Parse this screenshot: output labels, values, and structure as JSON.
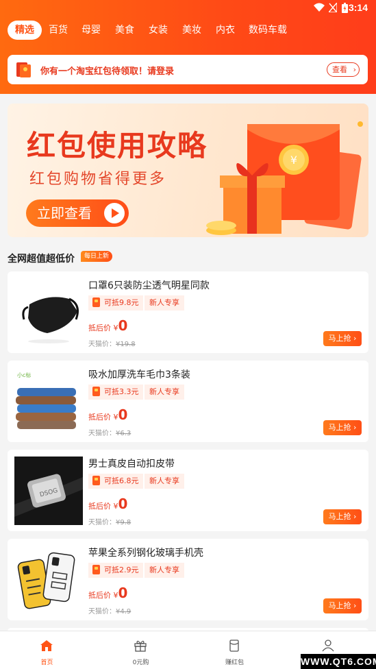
{
  "status_bar": {
    "time": "3:14"
  },
  "tabs": [
    "精选",
    "百货",
    "母婴",
    "美食",
    "女装",
    "美妆",
    "内衣",
    "数码车载"
  ],
  "notice": {
    "text": "你有一个淘宝红包待领取！请登录",
    "button": "查看"
  },
  "banner": {
    "title": "红包使用攻略",
    "subtitle": "红包购物省得更多",
    "cta": "立即查看"
  },
  "section": {
    "title": "全网超值超低价",
    "badge": "每日上新"
  },
  "products": [
    {
      "name": "口罩6只装防尘透气明星同款",
      "coupon": "可抵9.8元",
      "tag": "新人专享",
      "price_label": "抵后价 ¥",
      "price": "0",
      "orig_label": "天猫价：",
      "orig_price": "¥19.8",
      "button": "马上抢"
    },
    {
      "name": "吸水加厚洗车毛巾3条装",
      "coupon": "可抵3.3元",
      "tag": "新人专享",
      "price_label": "抵后价 ¥",
      "price": "0",
      "orig_label": "天猫价：",
      "orig_price": "¥6.3",
      "button": "马上抢"
    },
    {
      "name": "男士真皮自动扣皮带",
      "coupon": "可抵6.8元",
      "tag": "新人专享",
      "price_label": "抵后价 ¥",
      "price": "0",
      "orig_label": "天猫价：",
      "orig_price": "¥9.8",
      "button": "马上抢"
    },
    {
      "name": "苹果全系列钢化玻璃手机壳",
      "coupon": "可抵2.9元",
      "tag": "新人专享",
      "price_label": "抵后价 ¥",
      "price": "0",
      "orig_label": "天猫价：",
      "orig_price": "¥4.9",
      "button": "马上抢"
    }
  ],
  "bottom_nav": [
    "首页",
    "0元购",
    "赚红包",
    ""
  ],
  "watermark": "WWW.QT6.COM",
  "colors": {
    "accent": "#ff5416",
    "red": "#e8391e"
  }
}
